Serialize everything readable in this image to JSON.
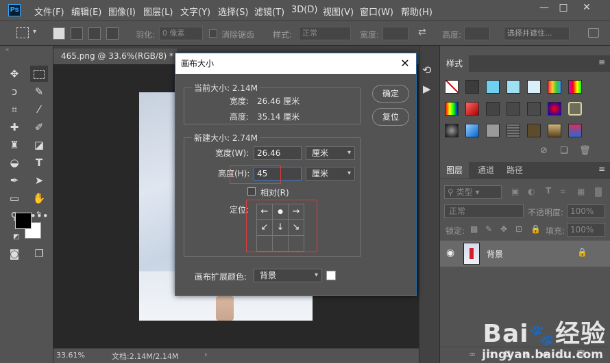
{
  "app": {
    "logo": "Ps"
  },
  "menu": [
    "文件(F)",
    "编辑(E)",
    "图像(I)",
    "图层(L)",
    "文字(Y)",
    "选择(S)",
    "滤镜(T)",
    "3D(D)",
    "视图(V)",
    "窗口(W)",
    "帮助(H)"
  ],
  "window_controls": [
    "minimize",
    "maximize",
    "close"
  ],
  "options": {
    "feather_label": "羽化:",
    "feather_value": "0 像素",
    "antialias_label": "消除锯齿",
    "style_label": "样式:",
    "style_value": "正常",
    "width_label": "宽度:",
    "height_label": "高度:",
    "select_mask": "选择并遮住..."
  },
  "document": {
    "tab_title": "465.png @ 33.6%(RGB/8) *",
    "zoom": "33.61%",
    "doc_size": "文档:2.14M/2.14M"
  },
  "dialog": {
    "title": "画布大小",
    "current_size": "当前大小: 2.14M",
    "cur_width_label": "宽度:",
    "cur_width": "26.46 厘米",
    "cur_height_label": "高度:",
    "cur_height": "35.14 厘米",
    "new_size": "新建大小: 2.74M",
    "new_width_label": "宽度(W):",
    "new_width": "26.46",
    "width_unit": "厘米",
    "new_height_label": "高度(H):",
    "new_height": "45",
    "height_unit": "厘米",
    "relative_label": "相对(R)",
    "anchor_label": "定位:",
    "anchor_grid": [
      "←",
      "●",
      "→",
      "↙",
      "↓",
      "↘",
      "",
      "",
      ""
    ],
    "ext_color_label": "画布扩展颜色:",
    "ext_color_value": "背景",
    "ext_color_swatch": "#ffffff",
    "ok": "确定",
    "reset": "复位"
  },
  "styles_panel": {
    "title": "样式"
  },
  "layers_panel": {
    "tabs": [
      "图层",
      "通道",
      "路径"
    ],
    "filter": "类型",
    "blend": "正常",
    "opacity_label": "不透明度:",
    "opacity": "100%",
    "lock_label": "锁定:",
    "fill_label": "填充:",
    "fill": "100%",
    "layer_name": "背景"
  },
  "watermark": {
    "brand": "Bai du 经验",
    "url": "jingyan.baidu.com"
  },
  "colors": {
    "accent": "#31a8ff",
    "highlight_box": "#e23b3b",
    "dialog_border": "#2f6aa3"
  }
}
